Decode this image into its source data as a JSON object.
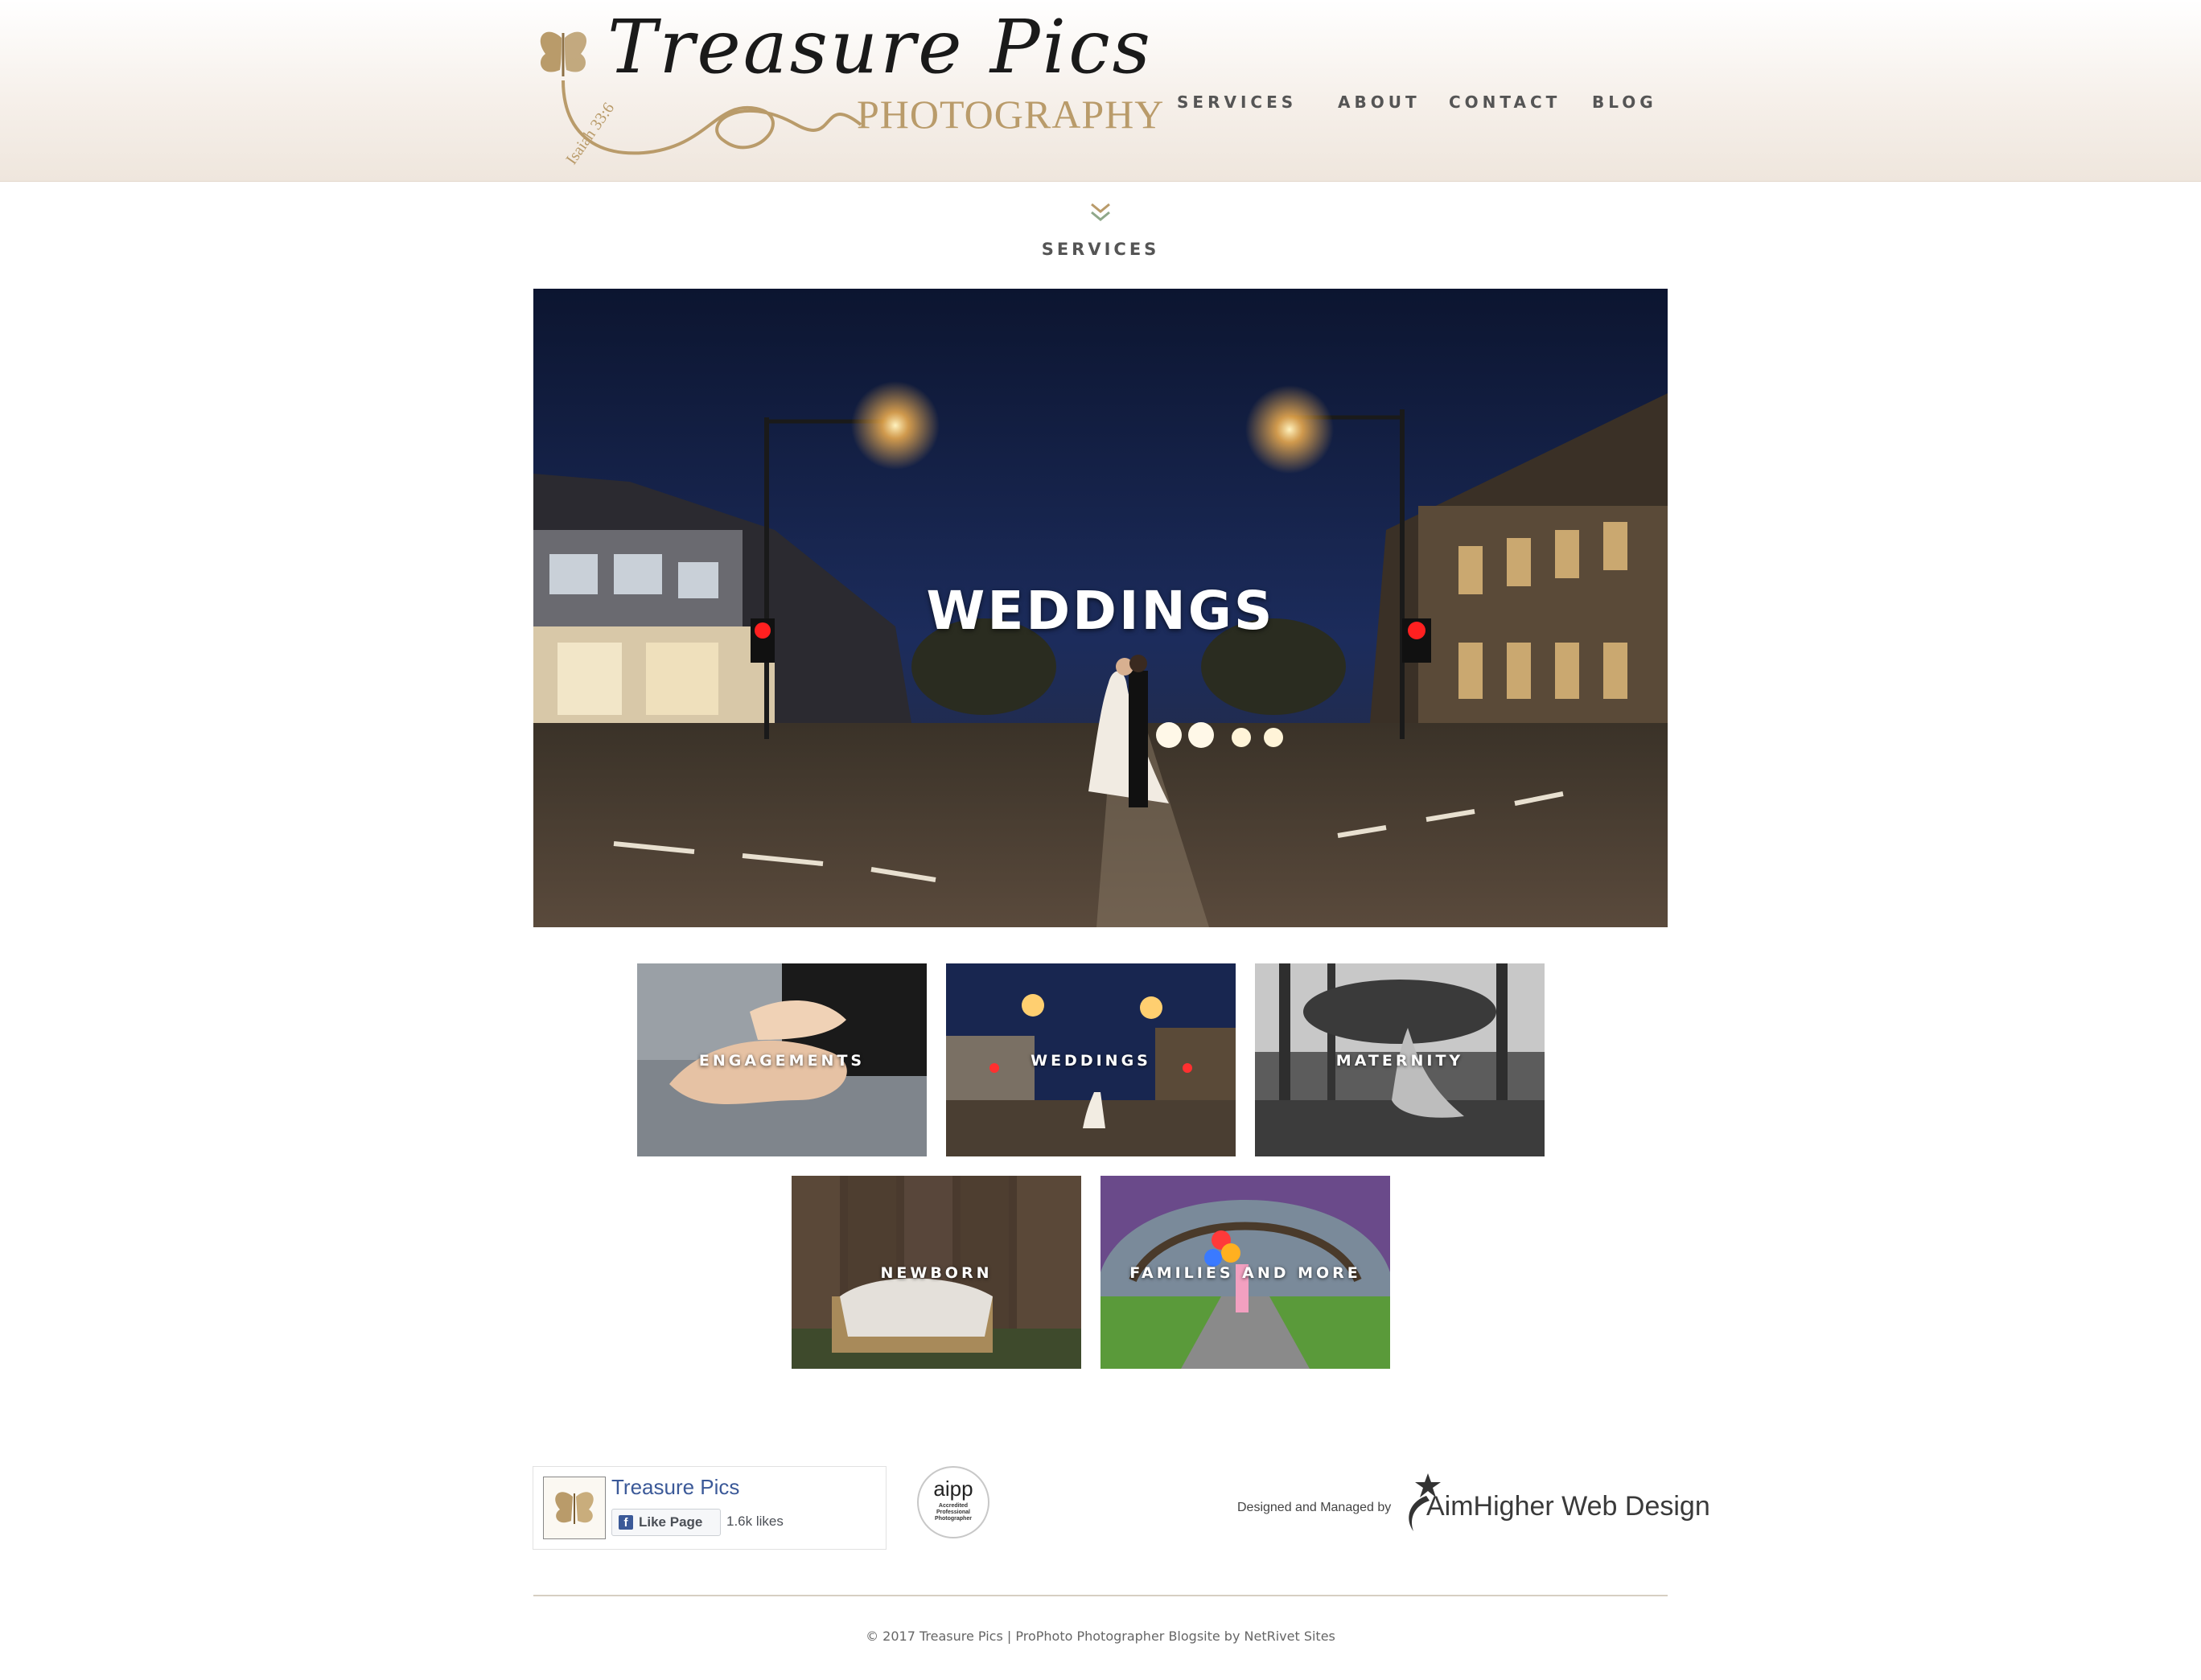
{
  "header": {
    "logo_script": "Treasure Pics",
    "logo_subtitle": "PHOTOGRAPHY",
    "logo_verse": "Isaiah 33:6",
    "nav": [
      "SERVICES",
      "ABOUT",
      "CONTACT",
      "BLOG"
    ]
  },
  "section": {
    "title": "SERVICES"
  },
  "hero": {
    "label": "WEDDINGS"
  },
  "thumbnails": [
    {
      "label": "ENGAGEMENTS"
    },
    {
      "label": "WEDDINGS"
    },
    {
      "label": "MATERNITY"
    },
    {
      "label": "NEWBORN"
    },
    {
      "label": "FAMILIES AND MORE"
    }
  ],
  "facebook": {
    "page_name": "Treasure Pics",
    "like_label": "Like Page",
    "likes": "1.6k likes"
  },
  "aipp": {
    "logo_text": "aipp",
    "badge_lines": [
      "Accredited",
      "Professional",
      "Photographer"
    ]
  },
  "credit": {
    "prefix": "Designed and Managed by",
    "brand": "AimHigher Web Design"
  },
  "footer": {
    "copyright": "© 2017 Treasure Pics  |  ProPhoto Photographer Blogsite by NetRivet Sites"
  },
  "colors": {
    "accent_gold": "#b99b6a",
    "nav_text": "#555555",
    "facebook_blue": "#3b5998"
  }
}
